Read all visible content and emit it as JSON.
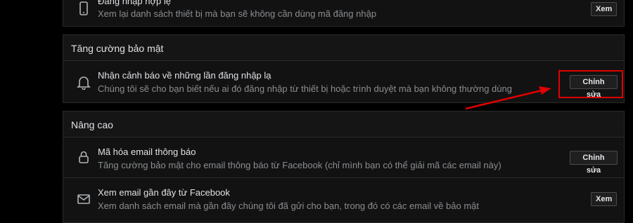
{
  "top_row": {
    "title": "Đăng nhập hợp lệ",
    "description": "Xem lại danh sách thiết bị mà bạn sẽ không cần dùng mã đăng nhập",
    "button": "Xem",
    "icon": "phone-icon"
  },
  "security_section": {
    "title": "Tăng cường bảo mật",
    "row": {
      "title": "Nhận cảnh báo về những lần đăng nhập lạ",
      "description": "Chúng tôi sẽ cho bạn biết nếu ai đó đăng nhập từ thiết bị hoặc trình duyệt mà bạn không thường dùng",
      "button": "Chỉnh sửa",
      "icon": "bell-icon"
    }
  },
  "advanced_section": {
    "title": "Nâng cao",
    "rows": [
      {
        "title": "Mã hóa email thông báo",
        "description": "Tăng cường bảo mật cho email thông báo từ Facebook (chỉ mình bạn có thể giải mã các email này)",
        "button": "Chỉnh sửa",
        "icon": "lock-icon"
      },
      {
        "title": "Xem email gần đây từ Facebook",
        "description": "Xem danh sách email mà gần đây chúng tôi đã gửi cho bạn, trong đó có các email về bảo mật",
        "button": "Xem",
        "icon": "envelope-icon"
      }
    ]
  },
  "annotation": {
    "color": "#e00000"
  }
}
